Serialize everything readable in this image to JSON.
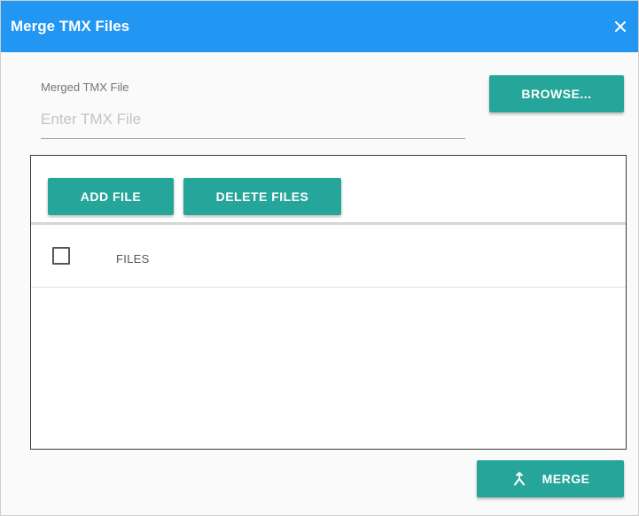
{
  "dialog": {
    "title": "Merge TMX Files",
    "close_icon": "close-icon"
  },
  "merged_file": {
    "label": "Merged TMX File",
    "value": "",
    "placeholder": "Enter TMX File",
    "browse_label": "BROWSE..."
  },
  "files_panel": {
    "add_label": "ADD FILE",
    "delete_label": "DELETE FILES",
    "columns": [
      "FILES"
    ],
    "rows": []
  },
  "footer": {
    "merge_label": "MERGE",
    "merge_icon": "merge-icon"
  },
  "colors": {
    "titlebar": "#2196f3",
    "button": "#26a69a",
    "button_text": "#ffffff"
  }
}
